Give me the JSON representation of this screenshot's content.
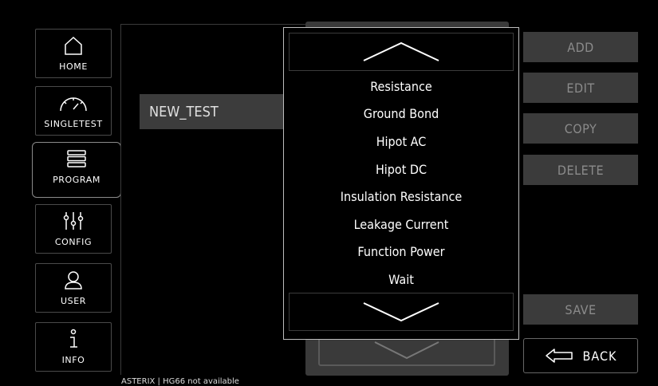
{
  "nav": {
    "home": "HOME",
    "singletest": "SINGLETEST",
    "program": "PROGRAM",
    "config": "CONFIG",
    "user": "USER",
    "info": "INFO"
  },
  "main": {
    "test_name": "NEW_TEST"
  },
  "actions": {
    "add": "ADD",
    "edit": "EDIT",
    "copy": "COPY",
    "delete": "DELETE",
    "save": "SAVE",
    "back": "BACK"
  },
  "dropdown": {
    "items": [
      "Resistance",
      "Ground Bond",
      "Hipot AC",
      "Hipot DC",
      "Insulation Resistance",
      "Leakage Current",
      "Function Power",
      "Wait"
    ]
  },
  "status": "ASTERIX | HG66 not available",
  "colors": {
    "button_bg": "#3b3b3b",
    "disabled_text": "#8b8b8b",
    "border": "#bdbdbd"
  }
}
